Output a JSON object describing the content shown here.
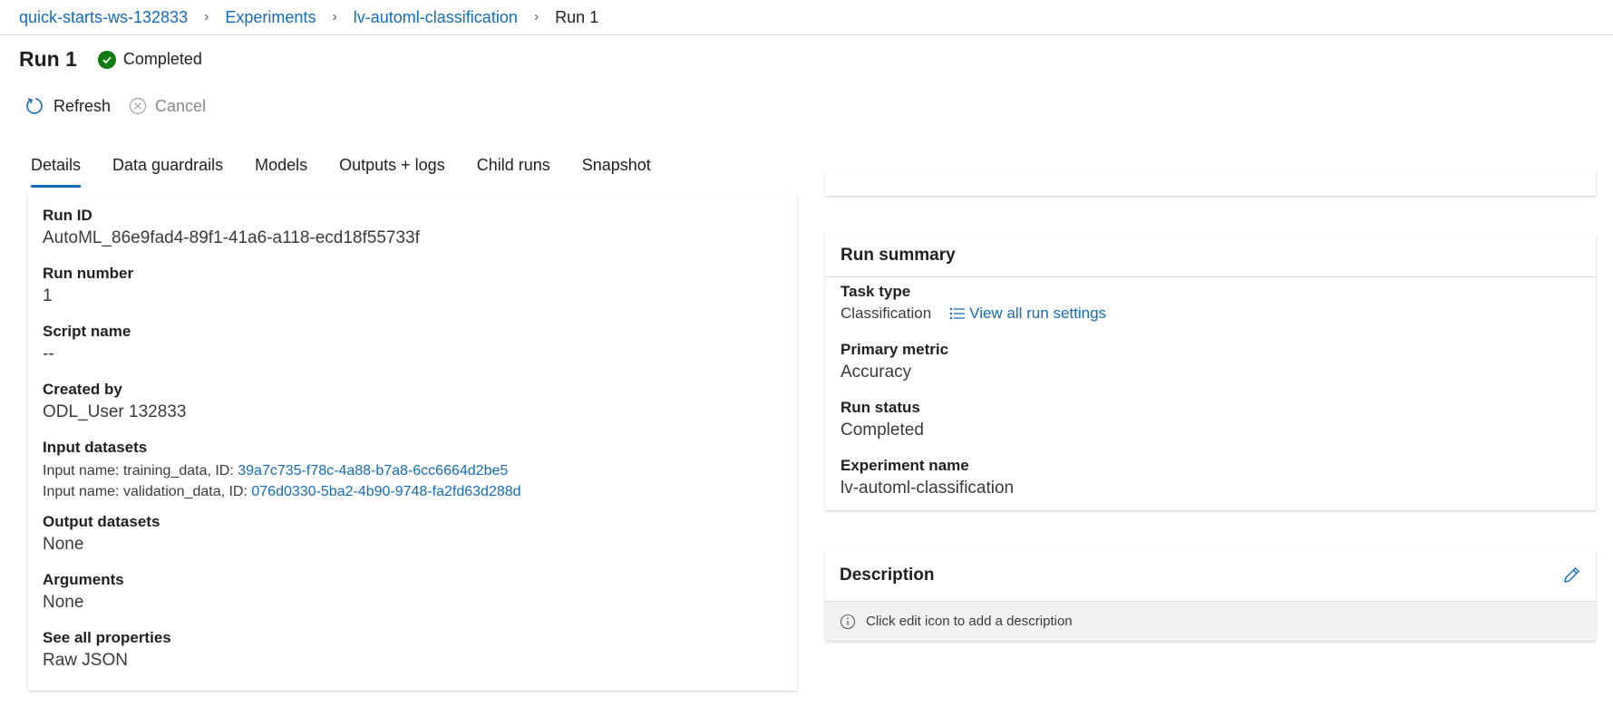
{
  "breadcrumb": [
    "quick-starts-ws-132833",
    "Experiments",
    "lv-automl-classification",
    "Run 1"
  ],
  "page": {
    "title": "Run 1",
    "status": "Completed"
  },
  "toolbar": {
    "refresh": "Refresh",
    "cancel": "Cancel"
  },
  "tabs": [
    "Details",
    "Data guardrails",
    "Models",
    "Outputs + logs",
    "Child runs",
    "Snapshot"
  ],
  "details": {
    "run_id_label": "Run ID",
    "run_id": "AutoML_86e9fad4-89f1-41a6-a118-ecd18f55733f",
    "run_number_label": "Run number",
    "run_number": "1",
    "script_name_label": "Script name",
    "script_name": "--",
    "created_by_label": "Created by",
    "created_by": "ODL_User 132833",
    "input_datasets_label": "Input datasets",
    "input1_prefix": "Input name: training_data, ID: ",
    "input1_id": "39a7c735-f78c-4a88-b7a8-6cc6664d2be5",
    "input2_prefix": "Input name: validation_data, ID: ",
    "input2_id": "076d0330-5ba2-4b90-9748-fa2fd63d288d",
    "output_datasets_label": "Output datasets",
    "output_datasets": "None",
    "arguments_label": "Arguments",
    "arguments": "None",
    "see_all_label": "See all properties",
    "raw_json": "Raw JSON"
  },
  "summary": {
    "title": "Run summary",
    "task_type_label": "Task type",
    "task_type": "Classification",
    "view_settings": "View all run settings",
    "primary_metric_label": "Primary metric",
    "primary_metric": "Accuracy",
    "run_status_label": "Run status",
    "run_status": "Completed",
    "experiment_name_label": "Experiment name",
    "experiment_name": "lv-automl-classification"
  },
  "description": {
    "title": "Description",
    "hint": "Click edit icon to add a description"
  },
  "colors": {
    "link": "#0f6cbd",
    "success": "#107c10",
    "text": "#201f1e"
  },
  "icons": [
    "chevron-right-icon",
    "check-circle-icon",
    "refresh-icon",
    "cancel-icon",
    "list-icon",
    "pencil-icon",
    "info-icon"
  ]
}
